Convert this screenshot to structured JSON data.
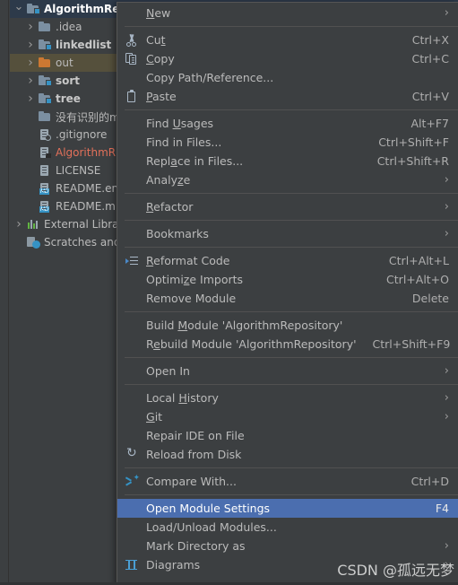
{
  "tree": {
    "rows": [
      {
        "indent": 0,
        "twisty": "open",
        "icon": "folder-module-icon",
        "label": "AlgorithmRep",
        "style": "head",
        "row_state": "selected-focused"
      },
      {
        "indent": 1,
        "twisty": "closed",
        "icon": "folder-icon",
        "label": ".idea",
        "style": "plain",
        "row_state": "none"
      },
      {
        "indent": 1,
        "twisty": "closed",
        "icon": "folder-module-icon",
        "label": "linkedlist",
        "style": "bold",
        "row_state": "none"
      },
      {
        "indent": 1,
        "twisty": "closed",
        "icon": "folder-orange-icon",
        "label": "out",
        "style": "plain",
        "row_state": "selected-out"
      },
      {
        "indent": 1,
        "twisty": "closed",
        "icon": "folder-module-icon",
        "label": "sort",
        "style": "bold",
        "row_state": "none"
      },
      {
        "indent": 1,
        "twisty": "closed",
        "icon": "folder-module-icon",
        "label": "tree",
        "style": "bold",
        "row_state": "none"
      },
      {
        "indent": 1,
        "twisty": "none",
        "icon": "folder-icon",
        "label": "没有识别的m",
        "style": "plain",
        "row_state": "none"
      },
      {
        "indent": 1,
        "twisty": "none",
        "icon": "gitignore-file-icon",
        "label": ".gitignore",
        "style": "plain",
        "row_state": "none"
      },
      {
        "indent": 1,
        "twisty": "none",
        "icon": "iml-file-icon",
        "label": "AlgorithmR",
        "style": "red",
        "row_state": "none"
      },
      {
        "indent": 1,
        "twisty": "none",
        "icon": "file-icon",
        "label": "LICENSE",
        "style": "plain",
        "row_state": "none"
      },
      {
        "indent": 1,
        "twisty": "none",
        "icon": "markdown-file-icon",
        "label": "README.en",
        "style": "plain",
        "row_state": "none"
      },
      {
        "indent": 1,
        "twisty": "none",
        "icon": "markdown-file-icon",
        "label": "README.m",
        "style": "plain",
        "row_state": "none"
      },
      {
        "indent": 0,
        "twisty": "closed",
        "icon": "external-libraries-icon",
        "label": "External Librar",
        "style": "plain",
        "row_state": "none"
      },
      {
        "indent": 0,
        "twisty": "none",
        "icon": "scratches-icon",
        "label": "Scratches and",
        "style": "plain",
        "row_state": "none"
      }
    ]
  },
  "context_menu": {
    "items": [
      {
        "kind": "item",
        "icon": "none",
        "label": "New",
        "mnemonic": "N",
        "accel": "",
        "submenu": true
      },
      {
        "kind": "separator"
      },
      {
        "kind": "item",
        "icon": "cut-icon",
        "label": "Cut",
        "mnemonic": "t",
        "accel": "Ctrl+X",
        "submenu": false
      },
      {
        "kind": "item",
        "icon": "copy-icon",
        "label": "Copy",
        "mnemonic": "C",
        "accel": "Ctrl+C",
        "submenu": false
      },
      {
        "kind": "item",
        "icon": "none",
        "label": "Copy Path/Reference...",
        "mnemonic": "",
        "accel": "",
        "submenu": false
      },
      {
        "kind": "item",
        "icon": "paste-icon",
        "label": "Paste",
        "mnemonic": "P",
        "accel": "Ctrl+V",
        "submenu": false
      },
      {
        "kind": "separator"
      },
      {
        "kind": "item",
        "icon": "none",
        "label": "Find Usages",
        "mnemonic": "U",
        "accel": "Alt+F7",
        "submenu": false
      },
      {
        "kind": "item",
        "icon": "none",
        "label": "Find in Files...",
        "mnemonic": "",
        "accel": "Ctrl+Shift+F",
        "submenu": false
      },
      {
        "kind": "item",
        "icon": "none",
        "label": "Replace in Files...",
        "mnemonic": "a",
        "accel": "Ctrl+Shift+R",
        "submenu": false
      },
      {
        "kind": "item",
        "icon": "none",
        "label": "Analyze",
        "mnemonic": "z",
        "accel": "",
        "submenu": true
      },
      {
        "kind": "separator"
      },
      {
        "kind": "item",
        "icon": "none",
        "label": "Refactor",
        "mnemonic": "R",
        "accel": "",
        "submenu": true
      },
      {
        "kind": "separator"
      },
      {
        "kind": "item",
        "icon": "none",
        "label": "Bookmarks",
        "mnemonic": "",
        "accel": "",
        "submenu": true
      },
      {
        "kind": "separator"
      },
      {
        "kind": "item",
        "icon": "reformat-code-icon",
        "label": "Reformat Code",
        "mnemonic": "R",
        "accel": "Ctrl+Alt+L",
        "submenu": false
      },
      {
        "kind": "item",
        "icon": "none",
        "label": "Optimize Imports",
        "mnemonic": "z",
        "accel": "Ctrl+Alt+O",
        "submenu": false
      },
      {
        "kind": "item",
        "icon": "none",
        "label": "Remove Module",
        "mnemonic": "",
        "accel": "Delete",
        "submenu": false
      },
      {
        "kind": "separator"
      },
      {
        "kind": "item",
        "icon": "none",
        "label": "Build Module 'AlgorithmRepository'",
        "mnemonic": "M",
        "accel": "",
        "submenu": false
      },
      {
        "kind": "item",
        "icon": "none",
        "label": "Rebuild Module 'AlgorithmRepository'",
        "mnemonic": "e",
        "accel": "Ctrl+Shift+F9",
        "submenu": false
      },
      {
        "kind": "separator"
      },
      {
        "kind": "item",
        "icon": "none",
        "label": "Open In",
        "mnemonic": "",
        "accel": "",
        "submenu": true
      },
      {
        "kind": "separator"
      },
      {
        "kind": "item",
        "icon": "none",
        "label": "Local History",
        "mnemonic": "H",
        "accel": "",
        "submenu": true
      },
      {
        "kind": "item",
        "icon": "none",
        "label": "Git",
        "mnemonic": "G",
        "accel": "",
        "submenu": true
      },
      {
        "kind": "item",
        "icon": "none",
        "label": "Repair IDE on File",
        "mnemonic": "",
        "accel": "",
        "submenu": false
      },
      {
        "kind": "item",
        "icon": "reload-icon",
        "label": "Reload from Disk",
        "mnemonic": "",
        "accel": "",
        "submenu": false
      },
      {
        "kind": "separator"
      },
      {
        "kind": "item",
        "icon": "compare-icon",
        "label": "Compare With...",
        "mnemonic": "",
        "accel": "Ctrl+D",
        "submenu": false
      },
      {
        "kind": "separator"
      },
      {
        "kind": "item",
        "icon": "none",
        "label": "Open Module Settings",
        "mnemonic": "",
        "accel": "F4",
        "submenu": false,
        "selected": true
      },
      {
        "kind": "item",
        "icon": "none",
        "label": "Load/Unload Modules...",
        "mnemonic": "",
        "accel": "",
        "submenu": false
      },
      {
        "kind": "item",
        "icon": "none",
        "label": "Mark Directory as",
        "mnemonic": "",
        "accel": "",
        "submenu": true
      },
      {
        "kind": "item",
        "icon": "diagrams-icon",
        "label": "Diagrams",
        "mnemonic": "",
        "accel": "",
        "submenu": true
      }
    ]
  },
  "watermark": {
    "text": "CSDN @孤远无梦"
  },
  "colors": {
    "menu_bg": "#3c3f41",
    "menu_border": "#565656",
    "selection_blue": "#4b6eaf",
    "tree_selection": "#2d3a4a",
    "out_folder_highlight": "#55503c",
    "accent_blue": "#3592c4",
    "orange_folder": "#cc7832",
    "red_text": "#e2705a",
    "text": "#bbbbbb"
  }
}
